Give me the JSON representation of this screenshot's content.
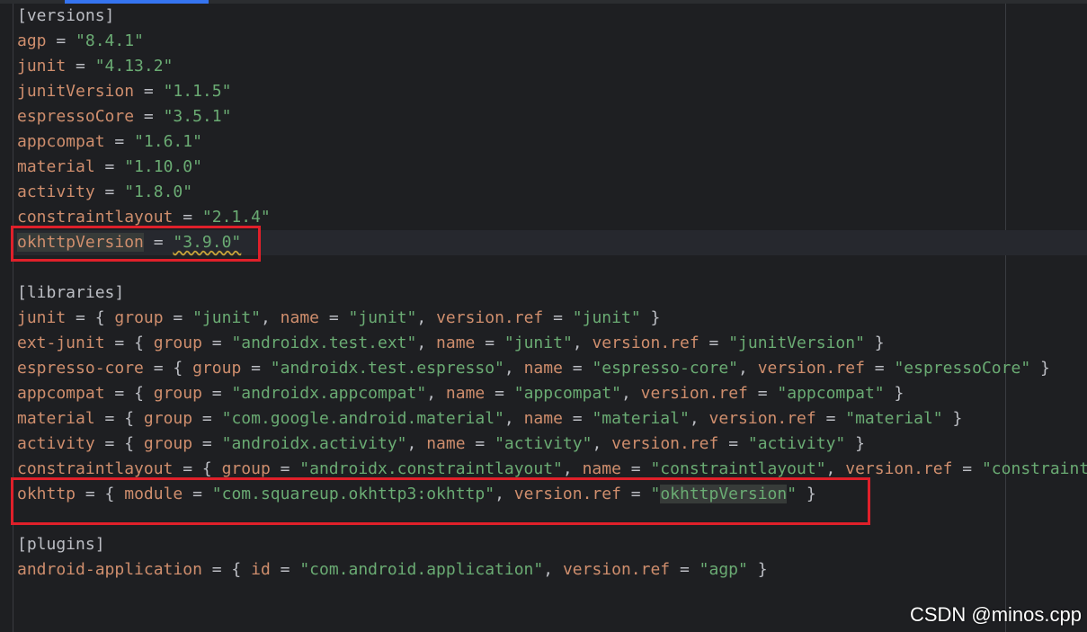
{
  "colors": {
    "background": "#1e1f22",
    "key": "#cf8e6d",
    "string": "#6aab73",
    "text": "#bcbec4",
    "highlight_box": "#e0202a"
  },
  "versions": {
    "header": "[versions]",
    "entries": [
      {
        "key": "agp",
        "value": "\"8.4.1\""
      },
      {
        "key": "junit",
        "value": "\"4.13.2\""
      },
      {
        "key": "junitVersion",
        "value": "\"1.1.5\""
      },
      {
        "key": "espressoCore",
        "value": "\"3.5.1\""
      },
      {
        "key": "appcompat",
        "value": "\"1.6.1\""
      },
      {
        "key": "material",
        "value": "\"1.10.0\""
      },
      {
        "key": "activity",
        "value": "\"1.8.0\""
      },
      {
        "key": "constraintlayout",
        "value": "\"2.1.4\""
      },
      {
        "key": "okhttpVersion",
        "value": "\"3.9.0\""
      }
    ]
  },
  "libraries": {
    "header": "[libraries]",
    "entries": [
      {
        "name": "junit",
        "group": "\"junit\"",
        "lib_name": "\"junit\"",
        "ref": "\"junit\""
      },
      {
        "name": "ext-junit",
        "group": "\"androidx.test.ext\"",
        "lib_name": "\"junit\"",
        "ref": "\"junitVersion\""
      },
      {
        "name": "espresso-core",
        "group": "\"androidx.test.espresso\"",
        "lib_name": "\"espresso-core\"",
        "ref": "\"espressoCore\""
      },
      {
        "name": "appcompat",
        "group": "\"androidx.appcompat\"",
        "lib_name": "\"appcompat\"",
        "ref": "\"appcompat\""
      },
      {
        "name": "material",
        "group": "\"com.google.android.material\"",
        "lib_name": "\"material\"",
        "ref": "\"material\""
      },
      {
        "name": "activity",
        "group": "\"androidx.activity\"",
        "lib_name": "\"activity\"",
        "ref": "\"activity\""
      },
      {
        "name": "constraintlayout",
        "group": "\"androidx.constraintlayout\"",
        "lib_name": "\"constraintlayout\"",
        "ref": "\"constraintlayout\""
      }
    ],
    "okhttp": {
      "name": "okhttp",
      "module": "\"com.squareup.okhttp3:okhttp\"",
      "ref_open": "\"",
      "ref_word": "okhttpVersion",
      "ref_close": "\""
    }
  },
  "plugins": {
    "header": "[plugins]",
    "entries": [
      {
        "name": "android-application",
        "id": "\"com.android.application\"",
        "ref": "\"agp\""
      }
    ]
  },
  "tokens": {
    "eq": " = ",
    "open": "{ ",
    "close": " }",
    "comma": ", ",
    "group": "group",
    "name": "name",
    "module": "module",
    "id": "id",
    "version_ref": "version.ref"
  },
  "watermark": "CSDN @minos.cpp"
}
